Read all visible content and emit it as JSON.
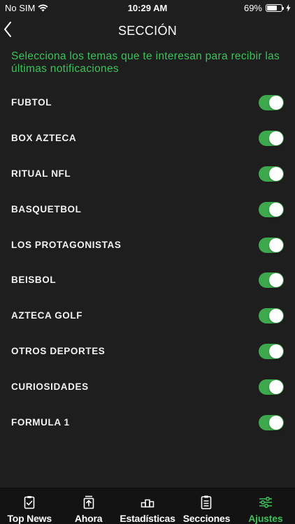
{
  "status_bar": {
    "carrier": "No SIM",
    "time": "10:29 AM",
    "battery_percent_label": "69%",
    "battery_level": 0.69
  },
  "header": {
    "title": "SECCIÓN"
  },
  "intro": {
    "text": "Selecciona los temas que te interesan para recibir las últimas notificaciones"
  },
  "topics": [
    {
      "label": "FUBTOL",
      "enabled": true
    },
    {
      "label": "BOX AZTECA",
      "enabled": true
    },
    {
      "label": "RITUAL NFL",
      "enabled": true
    },
    {
      "label": "BASQUETBOL",
      "enabled": true
    },
    {
      "label": "LOS PROTAGONISTAS",
      "enabled": true
    },
    {
      "label": "BEISBOL",
      "enabled": true
    },
    {
      "label": "AZTECA GOLF",
      "enabled": true
    },
    {
      "label": "OTROS DEPORTES",
      "enabled": true
    },
    {
      "label": "CURIOSIDADES",
      "enabled": true
    },
    {
      "label": "FORMULA 1",
      "enabled": true
    }
  ],
  "tab_bar": {
    "tabs": [
      {
        "label": "Top News",
        "icon": "clipboard-check-icon",
        "active": false
      },
      {
        "label": "Ahora",
        "icon": "upload-box-icon",
        "active": false
      },
      {
        "label": "Estadísticas",
        "icon": "podium-icon",
        "active": false
      },
      {
        "label": "Secciones",
        "icon": "list-document-icon",
        "active": false
      },
      {
        "label": "Ajustes",
        "icon": "sliders-icon",
        "active": true
      }
    ]
  },
  "colors": {
    "accent_green": "#3ec15a",
    "toggle_on": "#3ea84d",
    "background": "#1e1e1e",
    "tab_bar_bg": "#131313"
  }
}
